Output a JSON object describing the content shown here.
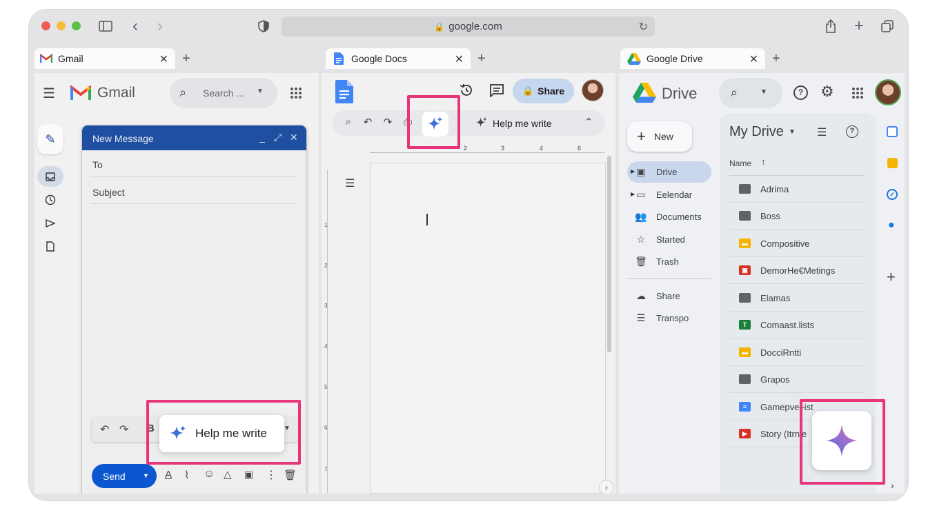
{
  "browser": {
    "url": "google.com",
    "tabs": [
      {
        "label": "Gmail"
      },
      {
        "label": "Google Docs"
      },
      {
        "label": "Google Drive"
      }
    ]
  },
  "gmail": {
    "logo_text": "Gmail",
    "search_placeholder": "Search ...",
    "compose": {
      "title": "New Message",
      "to_label": "To",
      "subject_label": "Subject",
      "send_label": "Send"
    },
    "help_me_write": "Help me write"
  },
  "docs": {
    "share_label": "Share",
    "help_me_write": "Help me write",
    "ruler_numbers": [
      "2",
      "3",
      "4",
      "6"
    ],
    "side_ruler_numbers": [
      "1",
      "2",
      "3",
      "4",
      "5",
      "6",
      "7"
    ]
  },
  "drive": {
    "logo_text": "Drive",
    "new_label": "New",
    "title": "My Drive",
    "name_header": "Name",
    "nav": [
      {
        "label": "Drive",
        "icon": "drive-icon"
      },
      {
        "label": "Eelendar",
        "icon": "computers-icon"
      },
      {
        "label": "Documents",
        "icon": "people-icon"
      },
      {
        "label": "Started",
        "icon": "star-icon"
      },
      {
        "label": "Trash",
        "icon": "trash-icon"
      },
      {
        "label": "Share",
        "icon": "cloud-icon"
      },
      {
        "label": "Transpo",
        "icon": "menu-icon"
      }
    ],
    "files": [
      {
        "name": "Adrima",
        "type": "folder",
        "color": "#5f6368"
      },
      {
        "name": "Boss",
        "type": "folder",
        "color": "#5f6368"
      },
      {
        "name": "Compositive",
        "type": "slides",
        "color": "#f4b400"
      },
      {
        "name": "DemorHe€Metings",
        "type": "presentation",
        "color": "#d93025"
      },
      {
        "name": "Elamas",
        "type": "folder",
        "color": "#5f6368"
      },
      {
        "name": "Comaast.lists",
        "type": "sheets",
        "color": "#188038"
      },
      {
        "name": "DocciRntti",
        "type": "slides",
        "color": "#f4b400"
      },
      {
        "name": "Grapos",
        "type": "folder",
        "color": "#5f6368"
      },
      {
        "name": "Gamepve–ist",
        "type": "docs",
        "color": "#4285f4"
      },
      {
        "name": "Story (Itrnle",
        "type": "video",
        "color": "#d93025"
      }
    ]
  },
  "colors": {
    "highlight": "#e8357a",
    "gmail_blue": "#0b57d0",
    "compose_header": "#1f4fa0"
  }
}
